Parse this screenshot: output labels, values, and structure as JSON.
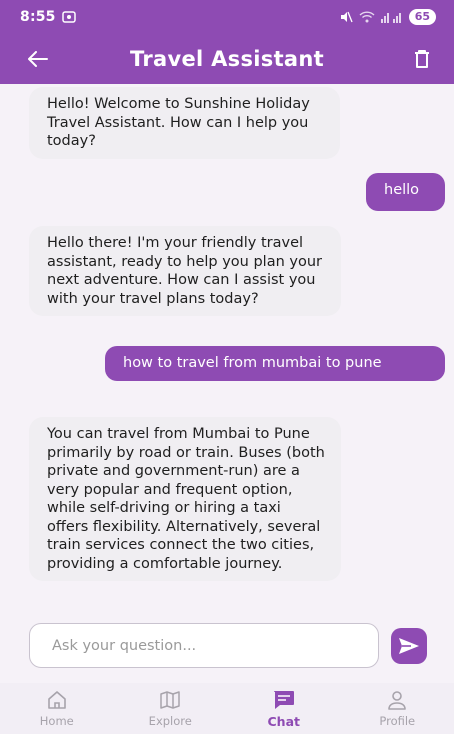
{
  "status_bar": {
    "time": "8:55",
    "battery": "65"
  },
  "app_bar": {
    "title": "Travel Assistant"
  },
  "messages": [
    {
      "sender": "bot",
      "text": "Hello! Welcome to Sunshine Holiday Travel Assistant. How can I help you today?"
    },
    {
      "sender": "user",
      "text": "hello"
    },
    {
      "sender": "bot",
      "text": "Hello there! I'm your friendly travel assistant, ready to help you plan your next adventure. How can I assist you with your travel plans today?"
    },
    {
      "sender": "user",
      "text": "how to travel from mumbai to pune"
    },
    {
      "sender": "bot",
      "text": "You can travel from Mumbai to Pune primarily by road or train. Buses (both private and government-run) are a very popular and frequent option, while self-driving or hiring a taxi offers flexibility. Alternatively, several train services connect the two cities, providing a comfortable journey."
    }
  ],
  "input": {
    "placeholder": "Ask your question...",
    "value": ""
  },
  "bottom_nav": [
    {
      "label": "Home",
      "icon": "home-icon",
      "active": false
    },
    {
      "label": "Explore",
      "icon": "map-icon",
      "active": false
    },
    {
      "label": "Chat",
      "icon": "chat-icon",
      "active": true
    },
    {
      "label": "Profile",
      "icon": "person-icon",
      "active": false
    }
  ],
  "colors": {
    "primary": "#8e4bb3",
    "bot_bubble": "#f0eef2",
    "background": "#f6f2f8",
    "nav_inactive": "#a7a3ab"
  }
}
